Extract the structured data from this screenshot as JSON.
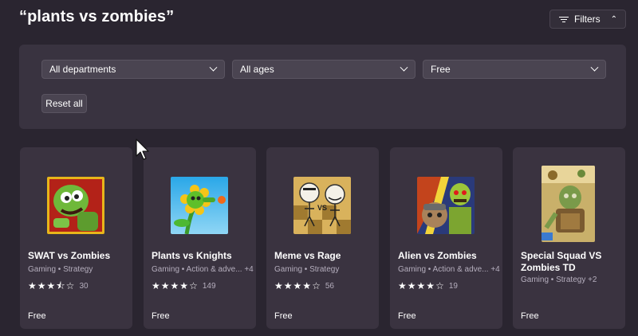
{
  "search": {
    "title": "“plants vs zombies”"
  },
  "filters_button": {
    "label": "Filters",
    "icon": "filter-icon",
    "chevron": "⌃"
  },
  "filter_panel": {
    "departments": {
      "selected": "All departments"
    },
    "ages": {
      "selected": "All ages"
    },
    "price": {
      "selected": "Free"
    },
    "reset_label": "Reset all"
  },
  "colors": {
    "background": "#2a2530",
    "panel": "#393340",
    "card": "#3a3340",
    "accent_text": "#b5aebd"
  },
  "apps": [
    {
      "name": "SWAT vs Zombies",
      "category": "Gaming • Strategy",
      "rating": 3.5,
      "stars": [
        "★",
        "★",
        "★",
        "⯪",
        "☆"
      ],
      "reviews": "30",
      "price": "Free"
    },
    {
      "name": "Plants vs Knights",
      "category": "Gaming • Action & adve... +4",
      "rating": 4,
      "stars": [
        "★",
        "★",
        "★",
        "★",
        "☆"
      ],
      "reviews": "149",
      "price": "Free"
    },
    {
      "name": "Meme vs Rage",
      "category": "Gaming • Strategy",
      "rating": 4,
      "stars": [
        "★",
        "★",
        "★",
        "★",
        "☆"
      ],
      "reviews": "56",
      "price": "Free"
    },
    {
      "name": "Alien vs Zombies",
      "category": "Gaming • Action & adve... +4",
      "rating": 4,
      "stars": [
        "★",
        "★",
        "★",
        "★",
        "☆"
      ],
      "reviews": "19",
      "price": "Free"
    },
    {
      "name": "Special Squad VS Zombies TD",
      "category": "Gaming • Strategy +2",
      "price": "Free"
    }
  ]
}
